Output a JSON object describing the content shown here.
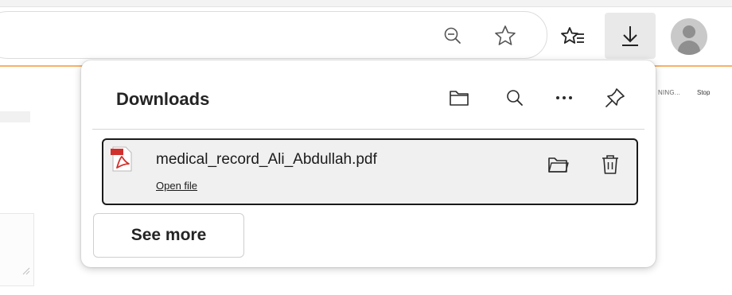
{
  "browser": {
    "icons": {
      "zoom": "zoom-out-icon",
      "favorite": "star-icon",
      "favorites_hub": "favorites-icon",
      "downloads": "download-arrow-icon",
      "profile": "profile-avatar-icon"
    }
  },
  "background_page": {
    "text_1": "NING...",
    "text_2": "Stop"
  },
  "downloads": {
    "title": "Downloads",
    "actions": {
      "open_folder": "folder-icon",
      "search": "search-icon",
      "more": "more-options-icon",
      "pin": "pin-icon"
    },
    "items": [
      {
        "file_name": "medical_record_Ali_Abdullah.pdf",
        "link_label": "Open file",
        "file_type_icon": "pdf-icon",
        "actions": {
          "show_in_folder": "folder-icon",
          "delete": "trash-icon"
        }
      }
    ],
    "see_more_label": "See more"
  },
  "colors": {
    "accent_rule": "#f7b267",
    "selected_item_border": "#1a1a1a",
    "pdf_red": "#d0312d"
  }
}
